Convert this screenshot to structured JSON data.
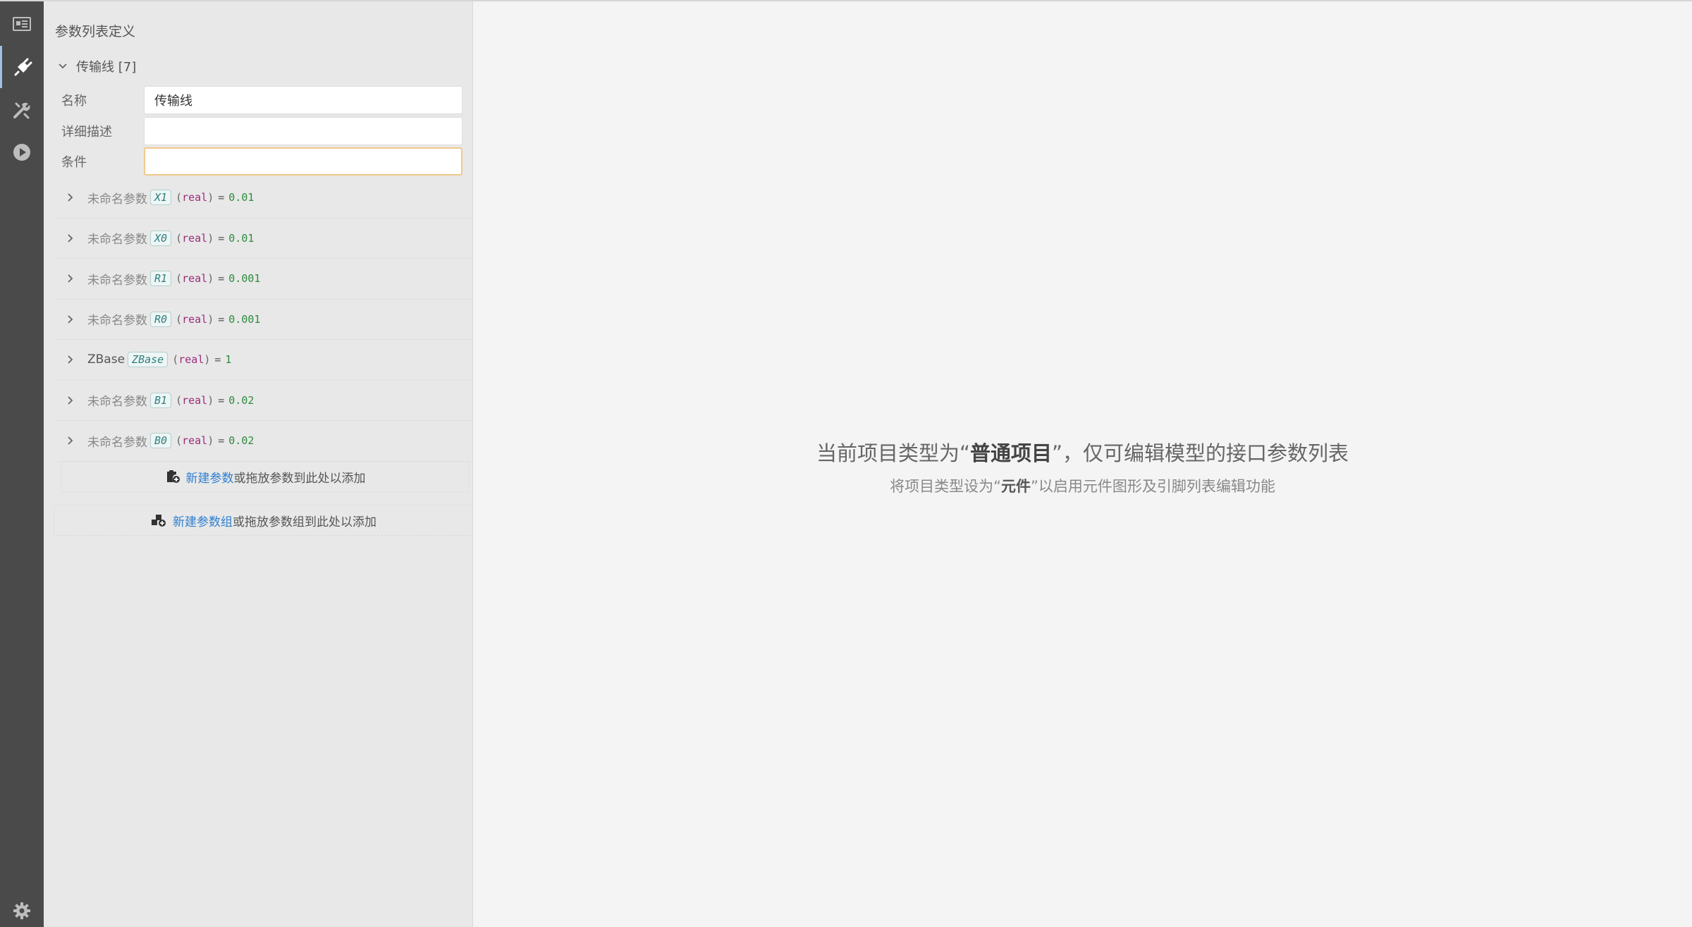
{
  "activity_bar": {
    "items": [
      {
        "name": "overview-icon"
      },
      {
        "name": "plug-icon",
        "active": true
      },
      {
        "name": "tools-icon"
      },
      {
        "name": "run-icon"
      }
    ],
    "bottom": {
      "name": "gear-icon"
    }
  },
  "panel": {
    "title": "参数列表定义",
    "group": {
      "label": "传输线 [7]",
      "expanded": true
    },
    "form": {
      "name_label": "名称",
      "name_value": "传输线",
      "desc_label": "详细描述",
      "desc_value": "",
      "cond_label": "条件",
      "cond_value": ""
    },
    "params": [
      {
        "name": "未命名参数",
        "key": "X1",
        "type": "real",
        "value": "0.01",
        "named": false
      },
      {
        "name": "未命名参数",
        "key": "X0",
        "type": "real",
        "value": "0.01",
        "named": false
      },
      {
        "name": "未命名参数",
        "key": "R1",
        "type": "real",
        "value": "0.001",
        "named": false
      },
      {
        "name": "未命名参数",
        "key": "R0",
        "type": "real",
        "value": "0.001",
        "named": false
      },
      {
        "name": "ZBase",
        "key": "ZBase",
        "type": "real",
        "value": "1",
        "named": true
      },
      {
        "name": "未命名参数",
        "key": "B1",
        "type": "real",
        "value": "0.02",
        "named": false
      },
      {
        "name": "未命名参数",
        "key": "B0",
        "type": "real",
        "value": "0.02",
        "named": false
      }
    ],
    "add_param": {
      "link": "新建参数",
      "rest": "或拖放参数到此处以添加"
    },
    "add_group": {
      "link": "新建参数组",
      "rest": "或拖放参数组到此处以添加"
    }
  },
  "main": {
    "msg_prefix": "当前项目类型为“",
    "msg_bold": "普通项目",
    "msg_suffix": "”，仅可编辑模型的接口参数列表",
    "sub_prefix": "将项目类型设为“",
    "sub_bold": "元件",
    "sub_suffix": "”以启用元件图形及引脚列表编辑功能"
  },
  "colors": {
    "activity_bg": "#4a4a4a",
    "panel_bg": "#e8e8e8",
    "main_bg": "#f4f4f4",
    "link": "#2f7fd0",
    "value_green": "#2e8b3e",
    "type_purple": "#9a2c7a",
    "key_teal": "#2f7f7f",
    "focus_border": "#f0c98a"
  }
}
